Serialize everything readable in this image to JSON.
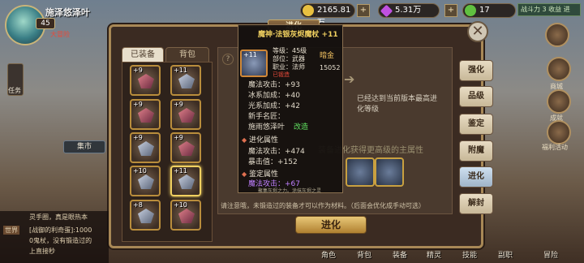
{
  "hud": {
    "player_name": "施泽悠泽叶",
    "level": "45",
    "vip_label": "大冒险",
    "gold": "2165.81万",
    "gems": "5.31万",
    "hearts": "17",
    "top_right_label": "战斗力 3 收益 进"
  },
  "left_side": {
    "quest_label": "任务",
    "market_label": "集市"
  },
  "dialog": {
    "title": "进化",
    "tabs": [
      "已装备",
      "背包"
    ],
    "max_level_text": "已经达到当前版本最高进化等级",
    "bg_text": "装备进化获得更高级的主属性",
    "hint": "请注意哦，未锻造过的装备才可以作为材料。（后面会优化成手动可选）",
    "evolve_button": "进化",
    "grid_levels": [
      "+9",
      "+11",
      "+9",
      "+9",
      "+9",
      "+9",
      "+9",
      "+9",
      "+10",
      "+11",
      "+8",
      "+10"
    ]
  },
  "side_tabs": [
    "强化",
    "品级",
    "鉴定",
    "附魔",
    "进化",
    "解封"
  ],
  "tooltip": {
    "name": "魔神·法银灰烬魔杖 +11",
    "badge": "+11",
    "quality": "暗金",
    "level_line": "等级：45级",
    "part_line": "部位：武器",
    "class_line": "职业：法师",
    "equipped": "已锻造",
    "score": "15052",
    "stats": [
      {
        "label": "魔法攻击：",
        "value": "+93"
      },
      {
        "label": "冰系加成：",
        "value": "+40"
      },
      {
        "label": "光系加成：",
        "value": "+42"
      }
    ],
    "smith_label": "新手名匠：",
    "smith_name": "施雨悠泽叶",
    "smith_action": "改造",
    "evo_header": "进化属性",
    "evo_stats": [
      {
        "label": "魔法攻击：",
        "value": "+474"
      },
      {
        "label": "暴击值：",
        "value": "+152"
      }
    ],
    "identify_header": "鉴定属性",
    "identify_stat": {
      "label": "魔法攻击：",
      "value": "+67"
    },
    "flavor": "聚集灰烬之力。涂抹灰烬之灵"
  },
  "chat": {
    "line1": "灵手圈，真是眼热本",
    "line2_tag": "世界",
    "line2": "[战御的利奇蛋]:1000",
    "line3": "0鬼杖，没有锻造过的",
    "line4": "上直接秒"
  },
  "right_side": {
    "shop": "商城",
    "achievement": "成就",
    "welfare": "福利活动"
  },
  "bottom_nav": [
    "角色",
    "背包",
    "装备",
    "精灵",
    "技能",
    "副职",
    "冒险"
  ]
}
